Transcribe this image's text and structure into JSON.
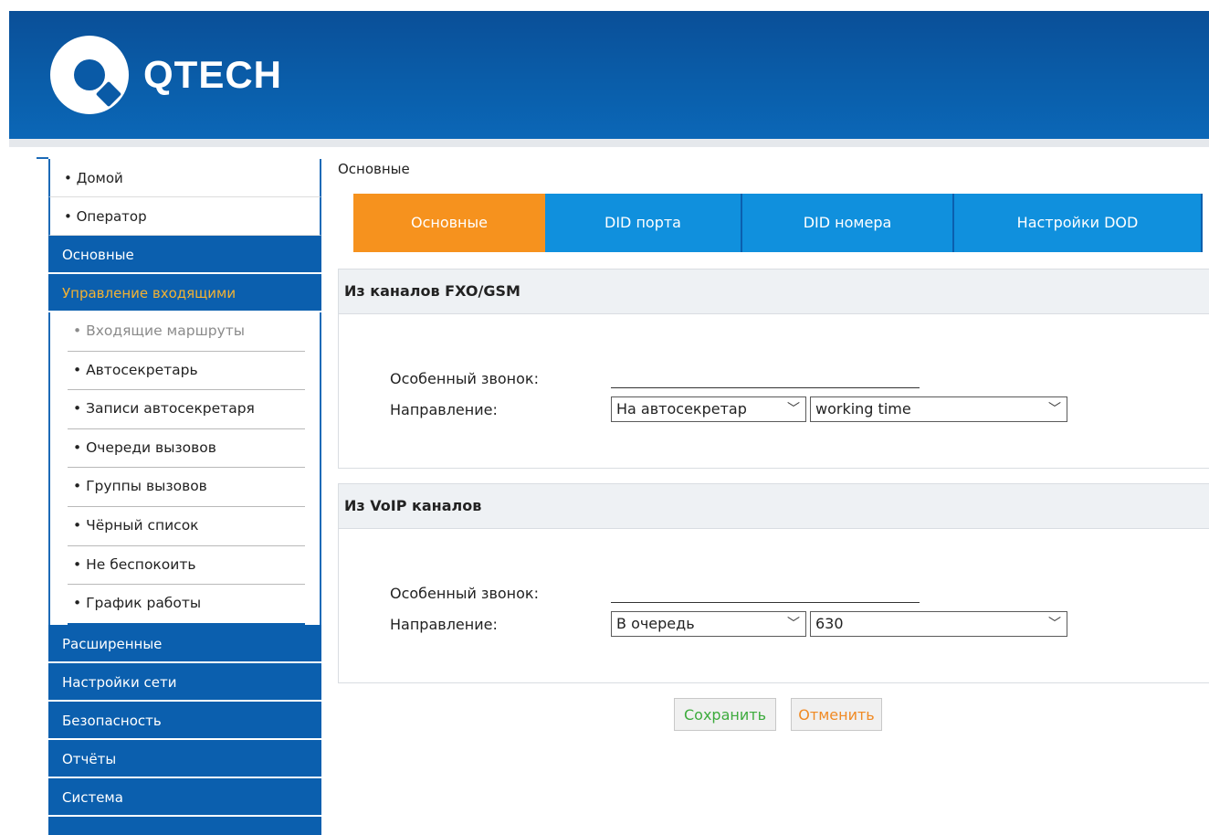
{
  "brand": {
    "name": "QTECH"
  },
  "sidebar": {
    "top_items": [
      {
        "label": "• Домой"
      },
      {
        "label": "• Оператор"
      }
    ],
    "sections": [
      {
        "label": "Основные"
      },
      {
        "label": "Управление входящими"
      }
    ],
    "sub_items": [
      {
        "label": "• Входящие маршруты"
      },
      {
        "label": "• Автосекретарь"
      },
      {
        "label": "• Записи автосекретаря"
      },
      {
        "label": "• Очереди вызовов"
      },
      {
        "label": "• Группы вызовов"
      },
      {
        "label": "• Чёрный список"
      },
      {
        "label": "• Не беспокоить"
      },
      {
        "label": "• График работы"
      }
    ],
    "bottom_sections": [
      {
        "label": "Расширенные"
      },
      {
        "label": "Настройки сети"
      },
      {
        "label": "Безопасность"
      },
      {
        "label": "Отчёты"
      },
      {
        "label": "Система"
      }
    ]
  },
  "main": {
    "page_title": "Основные",
    "tabs": [
      {
        "label": "Основные",
        "active": true
      },
      {
        "label": "DID порта"
      },
      {
        "label": "DID номера"
      },
      {
        "label": "Настройки DOD"
      }
    ],
    "panels": [
      {
        "title": "Из каналов FXO/GSM",
        "ring_label": "Особенный звонок:",
        "ring_value": "",
        "direction_label": "Направление:",
        "direction_type": "На автосекретар",
        "direction_target": "working time"
      },
      {
        "title": "Из VoIP каналов",
        "ring_label": "Особенный звонок:",
        "ring_value": "",
        "direction_label": "Направление:",
        "direction_type": "В очередь",
        "direction_target": "630"
      }
    ],
    "buttons": {
      "save": "Сохранить",
      "cancel": "Отменить"
    }
  },
  "colors": {
    "header_blue": "#0a5da9",
    "sidebar_section": "#0b5fae",
    "sidebar_active_text": "#f2b233",
    "tab_blue": "#1090dd",
    "tab_active": "#f6921e",
    "save_text": "#3dab3d",
    "cancel_text": "#f08a24"
  }
}
